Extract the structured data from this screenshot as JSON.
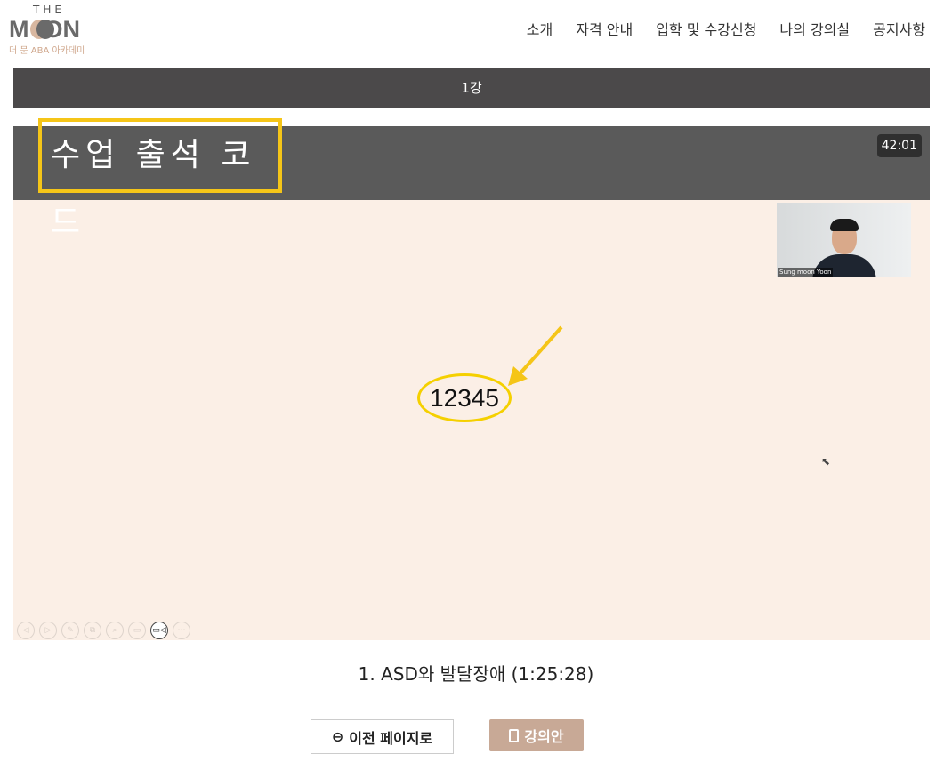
{
  "logo": {
    "the": "THE",
    "moon_m": "M",
    "moon_rest": "ON",
    "sub": "더 문 ABA 아카데미"
  },
  "nav": [
    "소개",
    "자격 안내",
    "입학 및 수강신청",
    "나의 강의실",
    "공지사항"
  ],
  "lecture_bar": "1강",
  "video": {
    "title": "수업 출석 코드",
    "timer": "42:01",
    "presenter": "Sung moon Yoon",
    "code": "12345",
    "controls": [
      "◁",
      "▷",
      "✎",
      "⧉",
      "⌕",
      "▭",
      "▭◁",
      "⋯"
    ]
  },
  "caption": "1. ASD와 발달장애 (1:25:28)",
  "buttons": {
    "prev": "이전 페이지로",
    "prev_icon": "⊖",
    "plan": "강의안"
  }
}
